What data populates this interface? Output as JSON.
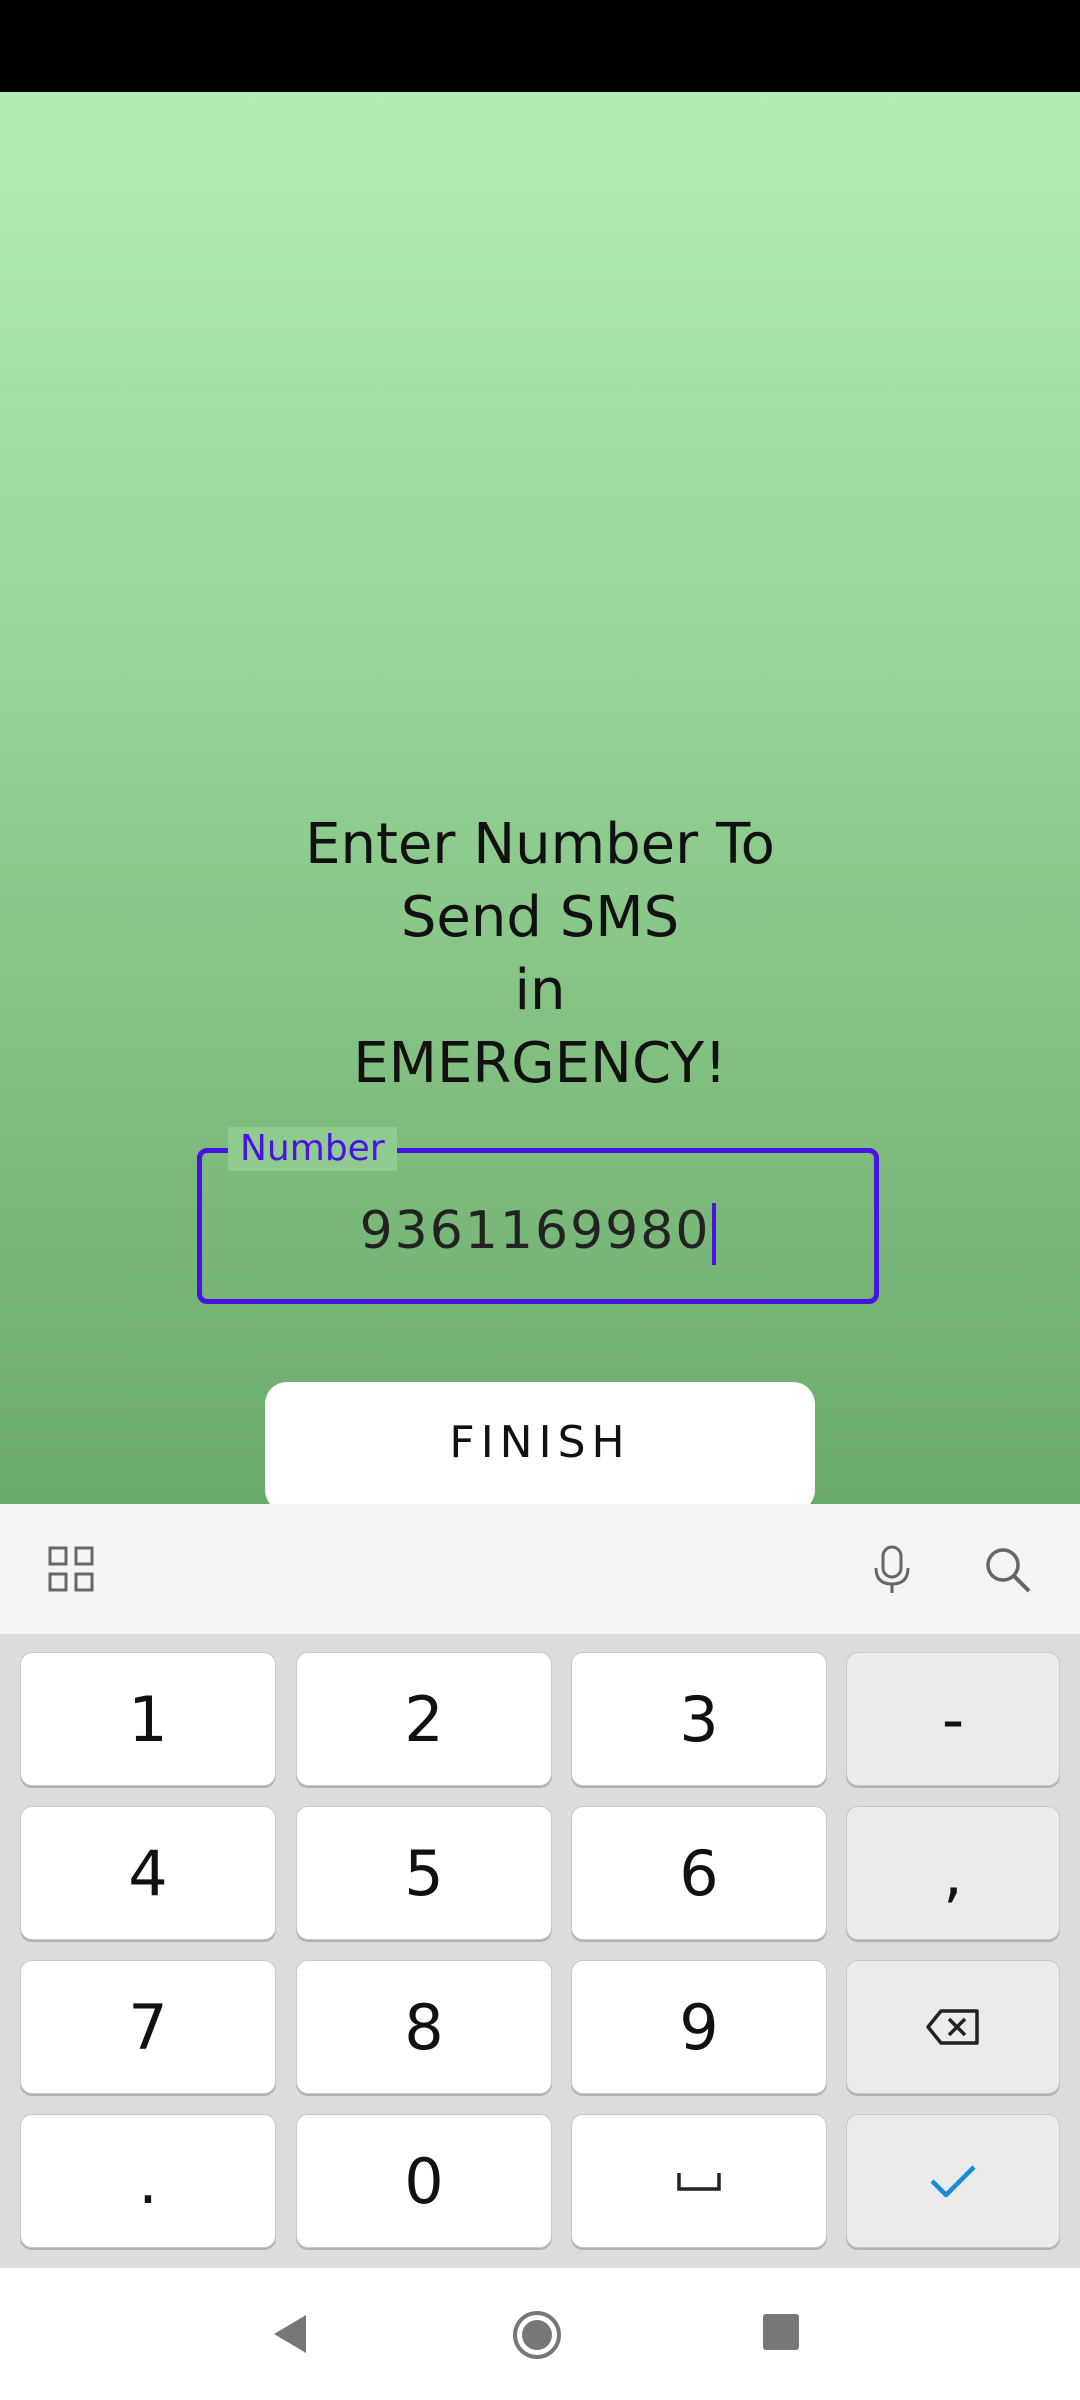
{
  "heading": {
    "line1": "Enter Number To",
    "line2": "Send SMS",
    "line3": "in",
    "line4": "EMERGENCY!"
  },
  "number_field": {
    "label": "Number",
    "value": "9361169980"
  },
  "finish_button": {
    "label": "FINISH"
  },
  "toolbar": {
    "icons": [
      "grid-icon",
      "microphone-icon",
      "search-icon"
    ]
  },
  "keypad": {
    "row1": [
      "1",
      "2",
      "3",
      "-"
    ],
    "row2": [
      "4",
      "5",
      "6",
      ","
    ],
    "row3": [
      "7",
      "8",
      "9"
    ],
    "row4": [
      ".",
      "0"
    ],
    "function_icons": [
      "backspace-icon",
      "space-icon",
      "checkmark-icon"
    ]
  },
  "nav_bar": {
    "icons": [
      "back-icon",
      "home-icon",
      "recents-icon"
    ]
  },
  "colors": {
    "accent": "#4a14e0",
    "background_top": "#b3edb3",
    "background_bottom": "#6aaa6a",
    "check": "#1a8ad4"
  }
}
